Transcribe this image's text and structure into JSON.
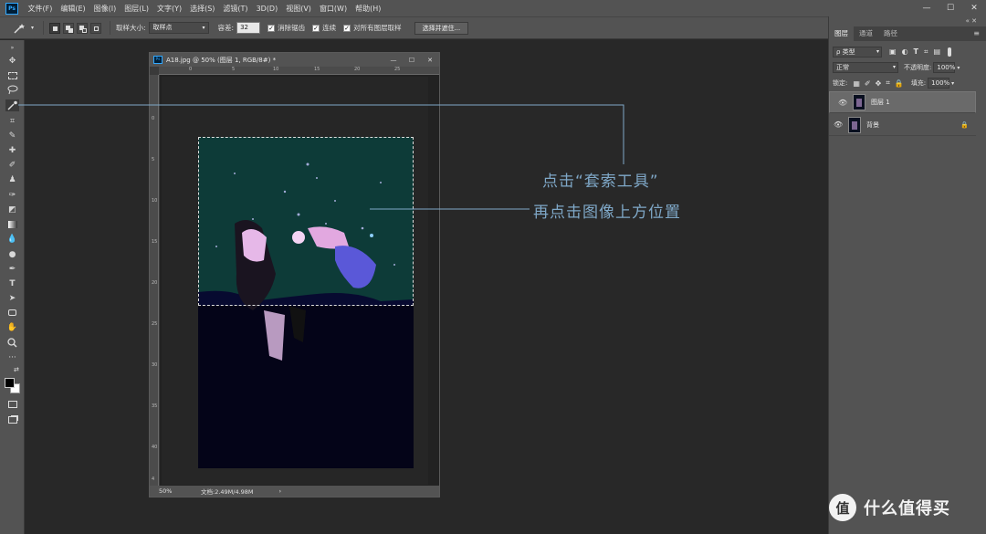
{
  "menu": {
    "app_icon": "Ps",
    "items": [
      "文件(F)",
      "编辑(E)",
      "图像(I)",
      "图层(L)",
      "文字(Y)",
      "选择(S)",
      "滤镜(T)",
      "3D(D)",
      "视图(V)",
      "窗口(W)",
      "帮助(H)"
    ],
    "window_controls": [
      "—",
      "☐",
      "✕"
    ]
  },
  "options": {
    "tool_icon": "magic-wand-icon",
    "sample_size_label": "取样大小:",
    "sample_size_value": "取样点",
    "tolerance_label": "容差:",
    "tolerance_value": "32",
    "antialias_label": "消除锯齿",
    "contiguous_label": "连续",
    "all_layers_label": "对所有图层取样",
    "select_mask_button": "选择并遮住..."
  },
  "document": {
    "app_icon": "Ps",
    "title": "A18.jpg @ 50% (图层 1, RGB/8#) *",
    "zoom": "50%",
    "doc_size": "文档:2.49M/4.98M",
    "hruler": [
      "0",
      "5",
      "10",
      "15",
      "20",
      "25"
    ],
    "vruler": [
      "0",
      "5",
      "10",
      "15",
      "20",
      "25",
      "30",
      "35",
      "40",
      "4"
    ],
    "status_arrow": "›"
  },
  "panel": {
    "tabs": [
      "图层",
      "通道",
      "路径"
    ],
    "filter_label": "ρ 类型",
    "blend_mode": "正常",
    "opacity_label": "不透明度:",
    "opacity_value": "100%",
    "lock_label": "锁定:",
    "fill_label": "填充:",
    "fill_value": "100%",
    "layers": [
      {
        "name": "图层 1",
        "selected": true,
        "locked": false
      },
      {
        "name": "背景",
        "selected": false,
        "locked": true
      }
    ]
  },
  "annotations": {
    "line1": "点击“套索工具”",
    "line2": "再点击图像上方位置"
  },
  "watermark": {
    "logo": "值",
    "text": "什么值得买"
  },
  "colors": {
    "annotation": "#7fa8c8",
    "ps_blue": "#31a8ff"
  }
}
